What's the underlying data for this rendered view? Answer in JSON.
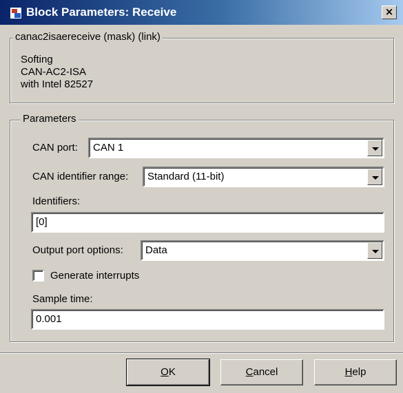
{
  "window": {
    "title": "Block Parameters: Receive",
    "close_glyph": "×"
  },
  "mask_group": {
    "legend": "canac2isaereceive (mask) (link)",
    "description_lines": [
      "Softing",
      "CAN-AC2-ISA",
      "with Intel 82527"
    ]
  },
  "parameters": {
    "legend": "Parameters",
    "can_port": {
      "label": "CAN port:",
      "value": "CAN 1"
    },
    "id_range": {
      "label": "CAN identifier range:",
      "value": "Standard (11-bit)"
    },
    "identifiers": {
      "label": "Identifiers:",
      "value": "[0]"
    },
    "output_port": {
      "label": "Output port options:",
      "value": "Data"
    },
    "generate_interrupts": {
      "label": "Generate interrupts",
      "checked": false
    },
    "sample_time": {
      "label": "Sample time:",
      "value": "0.001"
    }
  },
  "buttons": {
    "ok": {
      "mnemonic": "O",
      "rest": "K"
    },
    "cancel": {
      "mnemonic": "C",
      "rest": "ancel"
    },
    "help": {
      "mnemonic": "H",
      "rest": "elp"
    }
  }
}
